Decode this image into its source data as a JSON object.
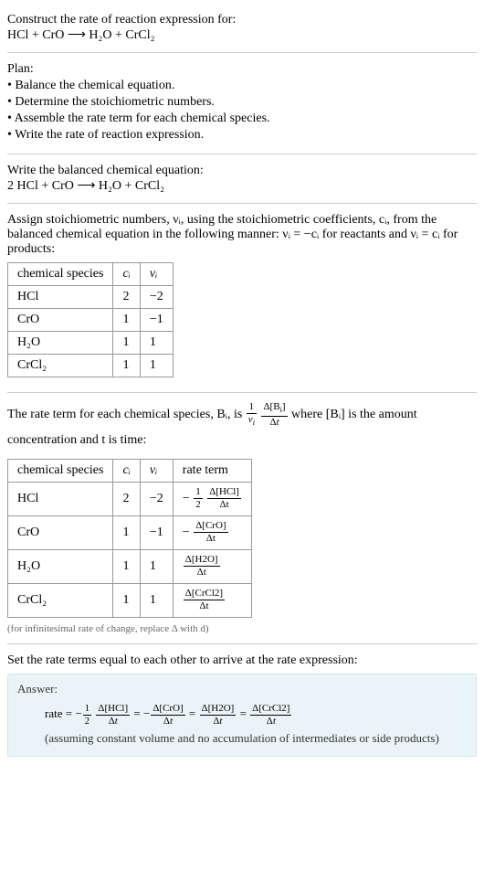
{
  "header": {
    "prompt": "Construct the rate of reaction expression for:",
    "equation": "HCl + CrO  ⟶  H₂O + CrCl₂"
  },
  "plan": {
    "title": "Plan:",
    "items": [
      "Balance the chemical equation.",
      "Determine the stoichiometric numbers.",
      "Assemble the rate term for each chemical species.",
      "Write the rate of reaction expression."
    ]
  },
  "balanced": {
    "title": "Write the balanced chemical equation:",
    "equation": "2 HCl + CrO  ⟶  H₂O + CrCl₂"
  },
  "stoich": {
    "intro_a": "Assign stoichiometric numbers, νᵢ, using the stoichiometric coefficients, cᵢ, from the balanced chemical equation in the following manner: νᵢ = −cᵢ for reactants and νᵢ = cᵢ for products:",
    "headers": [
      "chemical species",
      "cᵢ",
      "νᵢ"
    ],
    "rows": [
      {
        "species": "HCl",
        "c": "2",
        "v": "−2"
      },
      {
        "species": "CrO",
        "c": "1",
        "v": "−1"
      },
      {
        "species": "H₂O",
        "c": "1",
        "v": "1"
      },
      {
        "species": "CrCl₂",
        "c": "1",
        "v": "1"
      }
    ]
  },
  "rateterm": {
    "intro_pre": "The rate term for each chemical species, Bᵢ, is ",
    "intro_post": " where [Bᵢ] is the amount concentration and t is time:",
    "headers": [
      "chemical species",
      "cᵢ",
      "νᵢ",
      "rate term"
    ],
    "rows": [
      {
        "species": "HCl",
        "c": "2",
        "v": "−2",
        "rate_neg": "−",
        "rate_coef_num": "1",
        "rate_coef_den": "2",
        "rate_num": "Δ[HCl]",
        "rate_den": "Δt"
      },
      {
        "species": "CrO",
        "c": "1",
        "v": "−1",
        "rate_neg": "−",
        "rate_coef_num": "",
        "rate_coef_den": "",
        "rate_num": "Δ[CrO]",
        "rate_den": "Δt"
      },
      {
        "species": "H₂O",
        "c": "1",
        "v": "1",
        "rate_neg": "",
        "rate_coef_num": "",
        "rate_coef_den": "",
        "rate_num": "Δ[H2O]",
        "rate_den": "Δt"
      },
      {
        "species": "CrCl₂",
        "c": "1",
        "v": "1",
        "rate_neg": "",
        "rate_coef_num": "",
        "rate_coef_den": "",
        "rate_num": "Δ[CrCl2]",
        "rate_den": "Δt"
      }
    ],
    "note": "(for infinitesimal rate of change, replace Δ with d)"
  },
  "final": {
    "intro": "Set the rate terms equal to each other to arrive at the rate expression:",
    "answer_label": "Answer:",
    "rate_label": "rate = ",
    "assumption": "(assuming constant volume and no accumulation of intermediates or side products)"
  },
  "chart_data": {
    "type": "table",
    "tables": [
      {
        "title": "stoichiometric numbers",
        "columns": [
          "chemical species",
          "c_i",
          "nu_i"
        ],
        "rows": [
          [
            "HCl",
            2,
            -2
          ],
          [
            "CrO",
            1,
            -1
          ],
          [
            "H2O",
            1,
            1
          ],
          [
            "CrCl2",
            1,
            1
          ]
        ]
      },
      {
        "title": "rate terms",
        "columns": [
          "chemical species",
          "c_i",
          "nu_i",
          "rate term"
        ],
        "rows": [
          [
            "HCl",
            2,
            -2,
            "-(1/2) d[HCl]/dt"
          ],
          [
            "CrO",
            1,
            -1,
            "- d[CrO]/dt"
          ],
          [
            "H2O",
            1,
            1,
            "d[H2O]/dt"
          ],
          [
            "CrCl2",
            1,
            1,
            "d[CrCl2]/dt"
          ]
        ]
      }
    ],
    "rate_expression": "rate = -(1/2) d[HCl]/dt = - d[CrO]/dt = d[H2O]/dt = d[CrCl2]/dt"
  }
}
